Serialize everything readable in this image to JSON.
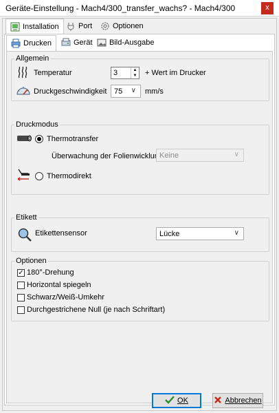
{
  "window": {
    "title": "Geräte-Einstellung -   Mach4/300_transfer_wachs?   - Mach4/300",
    "close_glyph": "x"
  },
  "top_tabs": [
    {
      "label": "Installation",
      "icon": "installation-icon",
      "active": true
    },
    {
      "label": "Port",
      "icon": "port-icon",
      "active": false
    },
    {
      "label": "Optionen",
      "icon": "options-gear-icon",
      "active": false
    }
  ],
  "sub_tabs": [
    {
      "label": "Drucken",
      "icon": "printer-icon",
      "active": true
    },
    {
      "label": "Gerät",
      "icon": "device-icon",
      "active": false
    },
    {
      "label": "Bild-Ausgabe",
      "icon": "image-output-icon",
      "active": false
    }
  ],
  "allgemein": {
    "legend": "Allgemein",
    "temperature_label": "Temperatur",
    "temperature_value": "3",
    "temperature_suffix": "+ Wert im Drucker",
    "speed_label": "Druckgeschwindigkeit",
    "speed_value": "75",
    "speed_unit": "mm/s"
  },
  "druckmodus": {
    "legend": "Druckmodus",
    "thermotransfer_label": "Thermotransfer",
    "thermotransfer_checked": true,
    "monitor_label": "Überwachung der Folienwicklung",
    "monitor_value": "Keine",
    "thermodirekt_label": "Thermodirekt",
    "thermodirekt_checked": false
  },
  "etikett": {
    "legend": "Etikett",
    "sensor_label": "Etikettensensor",
    "sensor_value": "Lücke"
  },
  "optionen": {
    "legend": "Optionen",
    "items": [
      {
        "label": "180°-Drehung",
        "checked": true
      },
      {
        "label": "Horizontal spiegeln",
        "checked": false
      },
      {
        "label": "Schwarz/Weiß-Umkehr",
        "checked": false
      },
      {
        "label": "Durchgestrichene Null (je nach Schriftart)",
        "checked": false
      }
    ]
  },
  "buttons": {
    "ok_label": "OK",
    "cancel_label": "Abbrechen"
  },
  "colors": {
    "accent": "#0078d7",
    "close": "#c42b1c",
    "ok_check": "#2e8b2e",
    "cancel_x": "#c42b1c"
  }
}
